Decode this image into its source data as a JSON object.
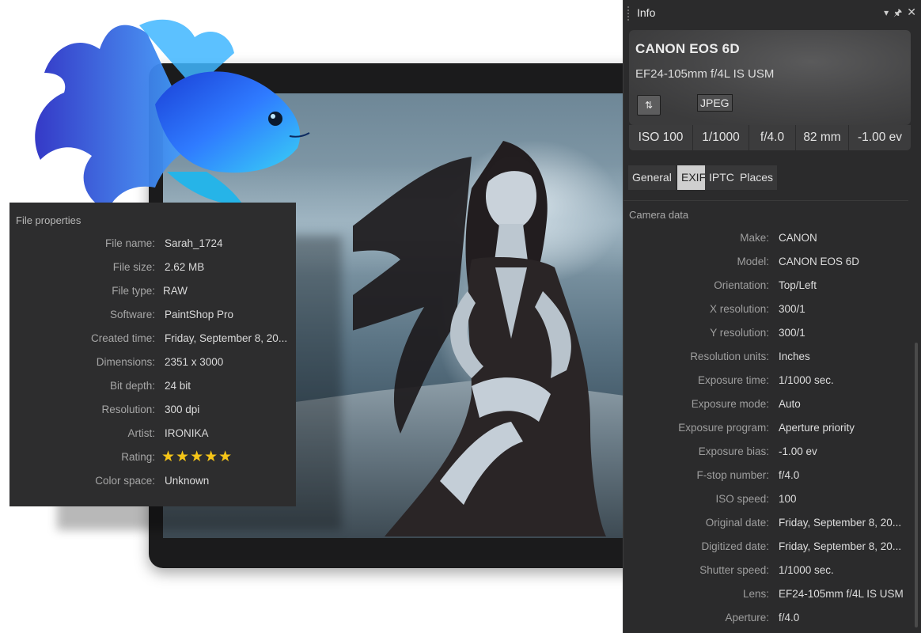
{
  "file_properties": {
    "title": "File properties",
    "rows": [
      {
        "label": "File name:",
        "value": "Sarah_1724"
      },
      {
        "label": "File size:",
        "value": "2.62 MB"
      },
      {
        "label": "File type:",
        "value": "RAW"
      },
      {
        "label": "Software:",
        "value": "PaintShop Pro"
      },
      {
        "label": "Created time:",
        "value": "Friday, September 8, 20..."
      },
      {
        "label": "Dimensions:",
        "value": "2351 x 3000"
      },
      {
        "label": "Bit depth:",
        "value": "24 bit"
      },
      {
        "label": "Resolution:",
        "value": "300 dpi"
      },
      {
        "label": "Artist:",
        "value": "IRONIKA"
      },
      {
        "label": "Rating:",
        "value": "★★★★★",
        "stars": 5
      },
      {
        "label": "Color space:",
        "value": "Unknown"
      }
    ]
  },
  "info_panel": {
    "title": "Info",
    "titlebar_icons": [
      "dropdown-icon",
      "pin-icon",
      "close-icon"
    ],
    "camera": {
      "model": "CANON EOS 6D",
      "lens": "EF24-105mm f/4L IS USM",
      "format": "JPEG",
      "toggle_icon": "up-down-chevron-icon"
    },
    "exposure": [
      "ISO 100",
      "1/1000",
      "f/4.0",
      "82 mm",
      "-1.00 ev"
    ],
    "tabs": [
      {
        "label": "General",
        "active": false
      },
      {
        "label": "EXIF",
        "active": true
      },
      {
        "label": "IPTC",
        "active": false
      },
      {
        "label": "Places",
        "active": false
      }
    ],
    "section_title": "Camera data",
    "rows": [
      {
        "label": "Make:",
        "value": "CANON"
      },
      {
        "label": "Model:",
        "value": "CANON EOS 6D"
      },
      {
        "label": "Orientation:",
        "value": "Top/Left"
      },
      {
        "label": "X resolution:",
        "value": "300/1"
      },
      {
        "label": "Y resolution:",
        "value": "300/1"
      },
      {
        "label": "Resolution units:",
        "value": "Inches"
      },
      {
        "label": "Exposure time:",
        "value": "1/1000 sec."
      },
      {
        "label": "Exposure mode:",
        "value": "Auto"
      },
      {
        "label": "Exposure program:",
        "value": "Aperture priority"
      },
      {
        "label": "Exposure bias:",
        "value": "-1.00 ev"
      },
      {
        "label": "F-stop number:",
        "value": "f/4.0"
      },
      {
        "label": "ISO speed:",
        "value": "100"
      },
      {
        "label": "Original date:",
        "value": "Friday, September 8, 20..."
      },
      {
        "label": "Digitized date:",
        "value": "Friday, September 8, 20..."
      },
      {
        "label": "Shutter speed:",
        "value": "1/1000 sec."
      },
      {
        "label": "Lens:",
        "value": "EF24-105mm f/4L IS USM"
      },
      {
        "label": "Aperture:",
        "value": "f/4.0"
      }
    ]
  },
  "colors": {
    "panel_bg": "#2b2b2c",
    "star": "#f5c518",
    "active_tab": "#cfcfcf"
  }
}
